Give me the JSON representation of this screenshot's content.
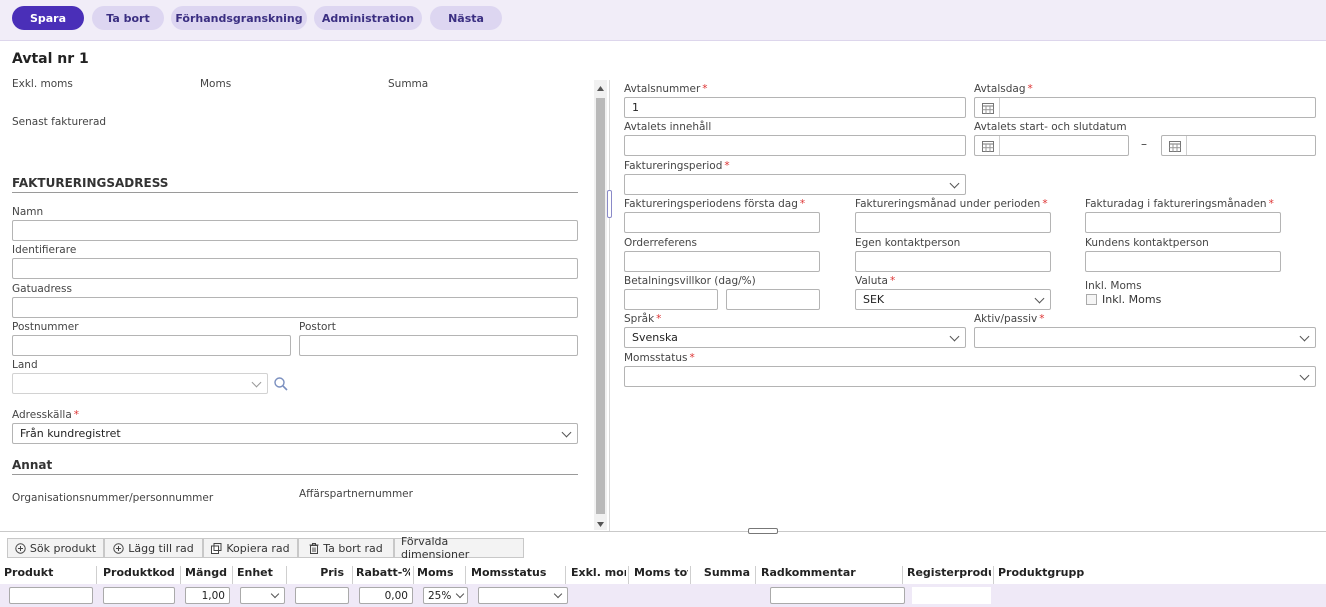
{
  "toolbar": {
    "save": "Spara",
    "delete": "Ta bort",
    "preview": "Förhandsgranskning",
    "admin": "Administration",
    "next": "Nästa"
  },
  "header": {
    "title": "Avtal nr 1",
    "excl_vat": "Exkl. moms",
    "vat": "Moms",
    "sum": "Summa",
    "last_invoiced": "Senast fakturerad"
  },
  "billing": {
    "title": "FAKTURERINGSADRESS",
    "name": "Namn",
    "identifier": "Identifierare",
    "street": "Gatuadress",
    "postal_code": "Postnummer",
    "city": "Postort",
    "country": "Land",
    "address_source": "Adresskälla",
    "address_source_value": "Från kundregistret"
  },
  "other": {
    "title": "Annat",
    "org_number": "Organisationsnummer/personnummer",
    "partner_number": "Affärspartnernummer"
  },
  "contract": {
    "number_label": "Avtalsnummer",
    "number_value": "1",
    "date_label": "Avtalsdag",
    "content_label": "Avtalets innehåll",
    "start_end_label": "Avtalets start- och slutdatum",
    "dash": "–",
    "period_label": "Faktureringsperiod",
    "period_first_day": "Faktureringsperiodens första dag",
    "period_month": "Faktureringsmånad under perioden",
    "invoice_day": "Fakturadag i faktureringsmånaden",
    "order_ref": "Orderreferens",
    "own_contact": "Egen kontaktperson",
    "customer_contact": "Kundens kontaktperson",
    "payment_terms": "Betalningsvillkor (dag/%)",
    "currency_label": "Valuta",
    "currency_value": "SEK",
    "incl_vat_label": "Inkl. Moms",
    "incl_vat_checkbox": "Inkl. Moms",
    "language_label": "Språk",
    "language_value": "Svenska",
    "active_label": "Aktiv/passiv",
    "vat_status_label": "Momsstatus"
  },
  "rows_toolbar": {
    "search": "Sök produkt",
    "add": "Lägg till rad",
    "copy": "Kopiera rad",
    "delete": "Ta bort rad",
    "dimensions": "Förvalda dimensioner"
  },
  "grid": {
    "columns": [
      "Produkt",
      "Produktkod",
      "Mängd",
      "Enhet",
      "Pris",
      "Rabatt-%",
      "Moms",
      "Momsstatus",
      "Exkl. moms",
      "Moms tota",
      "Summa",
      "Radkommentar",
      "Registerprodukt",
      "Produktgrupp"
    ],
    "quantity": "1,00",
    "discount": "0,00",
    "vat": "25%"
  },
  "colors": {
    "primary": "#4a2fb8",
    "pill": "#ddd6f1",
    "toolbar_bg": "#f1edf8",
    "required": "#dd3333"
  },
  "icons": [
    "calendar-icon",
    "chevron-down-icon",
    "search-icon",
    "plus-circle-icon",
    "copy-icon",
    "trash-icon"
  ]
}
